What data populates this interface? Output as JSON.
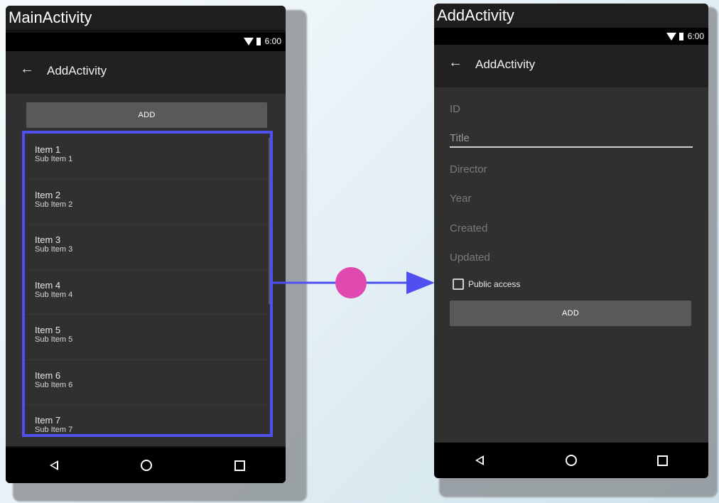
{
  "colors": {
    "highlight": "#5050f0",
    "connector_dot": "#e04ab0",
    "arrow": "#5050f0"
  },
  "left_phone": {
    "window_title": "MainActivity",
    "status": {
      "time": "6:00",
      "icons": [
        "wifi-icon",
        "battery-icon"
      ]
    },
    "toolbar": {
      "back_icon": "arrow-left-icon",
      "title": "AddActivity"
    },
    "add_button_label": "ADD",
    "list_items": [
      {
        "title": "Item 1",
        "subtitle": "Sub Item 1"
      },
      {
        "title": "Item 2",
        "subtitle": "Sub Item 2"
      },
      {
        "title": "Item 3",
        "subtitle": "Sub Item 3"
      },
      {
        "title": "Item 4",
        "subtitle": "Sub Item 4"
      },
      {
        "title": "Item 5",
        "subtitle": "Sub Item 5"
      },
      {
        "title": "Item 6",
        "subtitle": "Sub Item 6"
      },
      {
        "title": "Item 7",
        "subtitle": "Sub Item 7"
      }
    ],
    "nav": [
      "back-triangle-icon",
      "home-circle-icon",
      "recents-square-icon"
    ]
  },
  "right_phone": {
    "window_title": "AddActivity",
    "status": {
      "time": "6:00",
      "icons": [
        "wifi-icon",
        "battery-icon"
      ]
    },
    "toolbar": {
      "back_icon": "arrow-left-icon",
      "title": "AddActivity"
    },
    "fields": {
      "id": {
        "placeholder": "ID"
      },
      "title": {
        "placeholder": "Title"
      },
      "director": {
        "placeholder": "Director"
      },
      "year": {
        "placeholder": "Year"
      },
      "created": {
        "placeholder": "Created"
      },
      "updated": {
        "placeholder": "Updated"
      }
    },
    "checkbox": {
      "label": "Public access",
      "checked": false
    },
    "add_button_label": "ADD",
    "nav": [
      "back-triangle-icon",
      "home-circle-icon",
      "recents-square-icon"
    ]
  }
}
